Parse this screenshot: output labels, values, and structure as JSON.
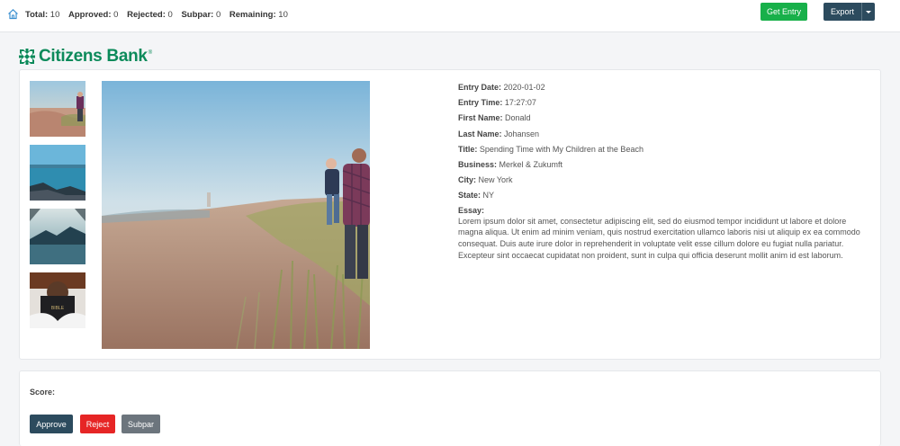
{
  "toolbar": {
    "stats": [
      {
        "label": "Total:",
        "value": "10"
      },
      {
        "label": "Approved:",
        "value": "0"
      },
      {
        "label": "Rejected:",
        "value": "0"
      },
      {
        "label": "Subpar:",
        "value": "0"
      },
      {
        "label": "Remaining:",
        "value": "10"
      }
    ],
    "get_entry_label": "Get Entry",
    "export_label": "Export",
    "home_icon": "home-icon",
    "accent_green": "#18b04a",
    "accent_navy": "#2c4b5e"
  },
  "brand": {
    "name": "Citizens Bank",
    "mark": "®",
    "color": "#0b8a5a"
  },
  "entry": {
    "fields": [
      {
        "label": "Entry Date:",
        "value": "2020-01-02"
      },
      {
        "label": "Entry Time:",
        "value": "17:27:07"
      },
      {
        "label": "First Name:",
        "value": "Donald"
      },
      {
        "label": "Last Name:",
        "value": "Johansen"
      },
      {
        "label": "Title:",
        "value": "Spending Time with My Children at the Beach"
      },
      {
        "label": "Business:",
        "value": "Merkel & Zukumft"
      },
      {
        "label": "City:",
        "value": "New York"
      },
      {
        "label": "State:",
        "value": "NY"
      }
    ],
    "essay_label": "Essay:",
    "essay": "Lorem ipsum dolor sit amet, consectetur adipiscing elit, sed do eiusmod tempor incididunt ut labore et dolore magna aliqua. Ut enim ad minim veniam, quis nostrud exercitation ullamco laboris nisi ut aliquip ex ea commodo consequat. Duis aute irure dolor in reprehenderit in voluptate velit esse cillum dolore eu fugiat nulla pariatur. Excepteur sint occaecat cupidatat non proident, sunt in culpa qui officia deserunt mollit anim id est laborum."
  },
  "score": {
    "label": "Score:",
    "approve_label": "Approve",
    "reject_label": "Reject",
    "subpar_label": "Subpar",
    "reject_color": "#e62525",
    "subpar_color": "#6c757d"
  }
}
